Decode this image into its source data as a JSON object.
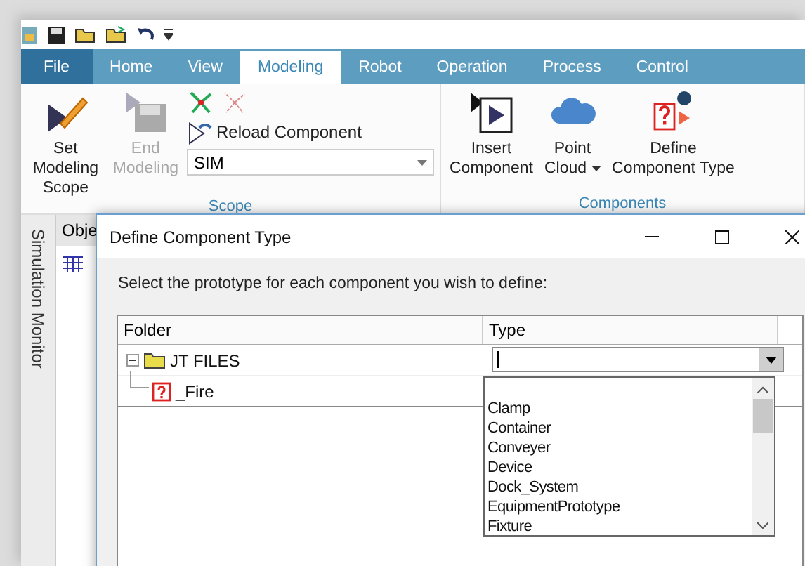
{
  "tabs": [
    {
      "label": "File",
      "kind": "file",
      "selected": false
    },
    {
      "label": "Home",
      "kind": "tab",
      "selected": false
    },
    {
      "label": "View",
      "kind": "tab",
      "selected": false
    },
    {
      "label": "Modeling",
      "kind": "tab",
      "selected": true
    },
    {
      "label": "Robot",
      "kind": "tab",
      "selected": false
    },
    {
      "label": "Operation",
      "kind": "tab",
      "selected": false
    },
    {
      "label": "Process",
      "kind": "tab",
      "selected": false
    },
    {
      "label": "Control",
      "kind": "tab",
      "selected": false
    }
  ],
  "ribbon": {
    "scope": {
      "label": "Scope",
      "set_modeling_scope": {
        "label": "Set Modeling Scope",
        "disabled": false
      },
      "end_modeling": {
        "label": "End Modeling",
        "disabled": true
      },
      "reload_component": {
        "label": "Reload Component"
      },
      "scope_combo": {
        "value": "SIM"
      }
    },
    "components": {
      "label": "Components",
      "insert_component": {
        "label": "Insert Component"
      },
      "point_cloud": {
        "label": "Point Cloud",
        "has_menu": true
      },
      "define_component_type": {
        "label": "Define Component Type"
      }
    }
  },
  "side_tab": {
    "label": "Simulation Monitor"
  },
  "objects_panel": {
    "header": "Obje"
  },
  "dialog": {
    "title": "Define Component Type",
    "instruction": "Select the prototype for each component you wish to define:",
    "columns": [
      "Folder",
      "Type"
    ],
    "tree": [
      {
        "label": "JT FILES",
        "kind": "folder",
        "expanded": true,
        "children": [
          {
            "label": "_Fire",
            "kind": "unknown"
          }
        ]
      }
    ],
    "type_combo": {
      "open": true
    },
    "type_options": [
      {
        "label": "Clamp",
        "selected": false
      },
      {
        "label": "Container",
        "selected": false
      },
      {
        "label": "Conveyer",
        "selected": false
      },
      {
        "label": "Device",
        "selected": false
      },
      {
        "label": "Dock_System",
        "selected": false
      },
      {
        "label": "EquipmentPrototype",
        "selected": false
      },
      {
        "label": "Fixture",
        "selected": false
      }
    ]
  }
}
